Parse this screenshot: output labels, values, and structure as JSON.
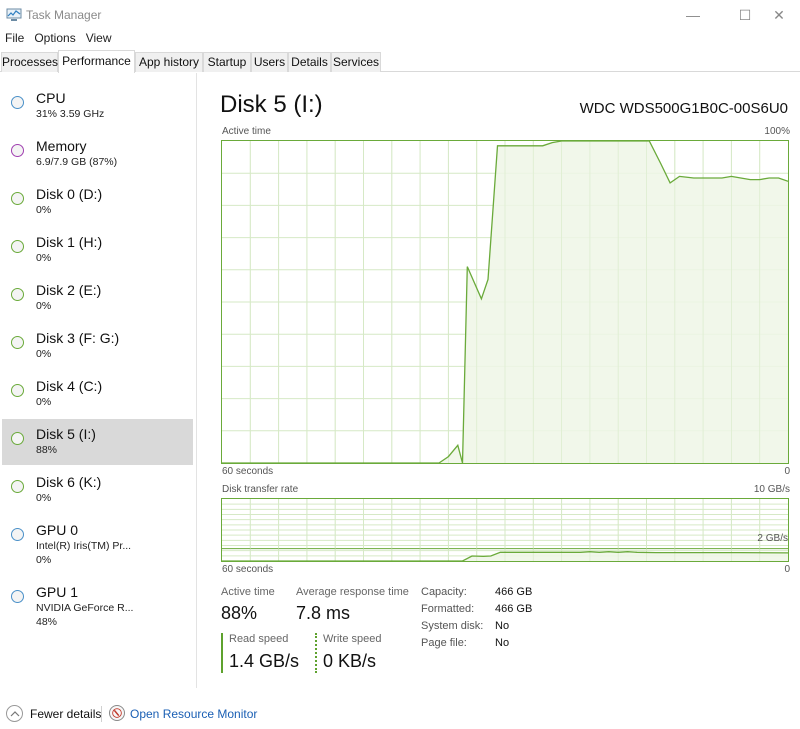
{
  "window": {
    "title": "Task Manager",
    "controls": {
      "minimize": "—",
      "maximize": "☐",
      "close": "✕"
    }
  },
  "menu": [
    "File",
    "Options",
    "View"
  ],
  "tabs": [
    {
      "label": "Processes",
      "active": false
    },
    {
      "label": "Performance",
      "active": true
    },
    {
      "label": "App history",
      "active": false
    },
    {
      "label": "Startup",
      "active": false
    },
    {
      "label": "Users",
      "active": false
    },
    {
      "label": "Details",
      "active": false
    },
    {
      "label": "Services",
      "active": false
    }
  ],
  "sidebar": {
    "items": [
      {
        "title": "CPU",
        "sub": "31%  3.59 GHz",
        "sub2": "",
        "color": "#4a90c8",
        "selected": false
      },
      {
        "title": "Memory",
        "sub": "6.9/7.9 GB (87%)",
        "sub2": "",
        "color": "#a040b0",
        "selected": false
      },
      {
        "title": "Disk 0 (D:)",
        "sub": "0%",
        "sub2": "",
        "color": "#6aaa3a",
        "selected": false
      },
      {
        "title": "Disk 1 (H:)",
        "sub": "0%",
        "sub2": "",
        "color": "#6aaa3a",
        "selected": false
      },
      {
        "title": "Disk 2 (E:)",
        "sub": "0%",
        "sub2": "",
        "color": "#6aaa3a",
        "selected": false
      },
      {
        "title": "Disk 3 (F: G:)",
        "sub": "0%",
        "sub2": "",
        "color": "#6aaa3a",
        "selected": false
      },
      {
        "title": "Disk 4 (C:)",
        "sub": "0%",
        "sub2": "",
        "color": "#6aaa3a",
        "selected": false
      },
      {
        "title": "Disk 5 (I:)",
        "sub": "88%",
        "sub2": "",
        "color": "#6aaa3a",
        "selected": true
      },
      {
        "title": "Disk 6 (K:)",
        "sub": "0%",
        "sub2": "",
        "color": "#6aaa3a",
        "selected": false
      },
      {
        "title": "GPU 0",
        "sub": "Intel(R) Iris(TM) Pr...",
        "sub2": "0%",
        "color": "#4a90c8",
        "selected": false
      },
      {
        "title": "GPU 1",
        "sub": "NVIDIA GeForce R...",
        "sub2": "48%",
        "color": "#4a90c8",
        "selected": false
      }
    ]
  },
  "main": {
    "title": "Disk 5 (I:)",
    "model": "WDC WDS500G1B0C-00S6U0",
    "stats": {
      "active_time_label": "Active time",
      "active_time_value": "88%",
      "avg_response_label": "Average response time",
      "avg_response_value": "7.8 ms",
      "read_speed_label": "Read speed",
      "read_speed_value": "1.4 GB/s",
      "write_speed_label": "Write speed",
      "write_speed_value": "0 KB/s"
    },
    "properties": [
      {
        "label": "Capacity:",
        "value": "466 GB"
      },
      {
        "label": "Formatted:",
        "value": "466 GB"
      },
      {
        "label": "System disk:",
        "value": "No"
      },
      {
        "label": "Page file:",
        "value": "No"
      }
    ]
  },
  "colors": {
    "accent": "#6aaa3a",
    "fill": "#eef6e6",
    "grid": "#d6e9c6",
    "link": "#1a5fb4"
  },
  "chart_data": [
    {
      "type": "area",
      "title": "Active time",
      "xlabel": "60 seconds",
      "x_end_label": "0",
      "ymax_label": "100%",
      "xlim": [
        60,
        0
      ],
      "ylim": [
        0,
        100
      ],
      "grid": true,
      "x_seconds_ago": [
        60,
        38,
        37,
        36,
        35,
        34.5,
        34,
        32.5,
        31.8,
        30.8,
        30,
        28,
        26,
        25,
        24,
        22,
        20,
        15,
        14.7,
        13.5,
        12.5,
        11.5,
        10,
        8,
        7,
        6,
        5,
        4,
        3,
        2,
        1,
        0
      ],
      "values": [
        0,
        0,
        0,
        2,
        5.5,
        0,
        61,
        51,
        57,
        98.5,
        98.5,
        98.5,
        98.5,
        99.5,
        100,
        100,
        100,
        100,
        100,
        93,
        87,
        89,
        88.5,
        88.5,
        88.5,
        89,
        88.5,
        88,
        88,
        88.5,
        88.5,
        87.5
      ]
    },
    {
      "type": "area",
      "title": "Disk transfer rate",
      "xlabel": "60 seconds",
      "x_end_label": "0",
      "ymax_label": "10 GB/s",
      "reference_label": "2 GB/s",
      "reference_value": 2,
      "xlim": [
        60,
        0
      ],
      "ylim": [
        0,
        10
      ],
      "grid": true,
      "series": [
        {
          "name": "Read speed",
          "x_seconds_ago": [
            60,
            34.5,
            33.5,
            32.3,
            31.5,
            30.5,
            29,
            25,
            22,
            21,
            20,
            19,
            18,
            17,
            16,
            14,
            10,
            5,
            0
          ],
          "values": [
            0,
            0,
            0.8,
            0.75,
            0.8,
            1.4,
            1.4,
            1.4,
            1.4,
            1.5,
            1.4,
            1.5,
            1.4,
            1.5,
            1.4,
            1.35,
            1.35,
            1.35,
            1.3
          ]
        }
      ]
    }
  ],
  "footer": {
    "fewer_details": "Fewer details",
    "open_resource_monitor": "Open Resource Monitor"
  }
}
